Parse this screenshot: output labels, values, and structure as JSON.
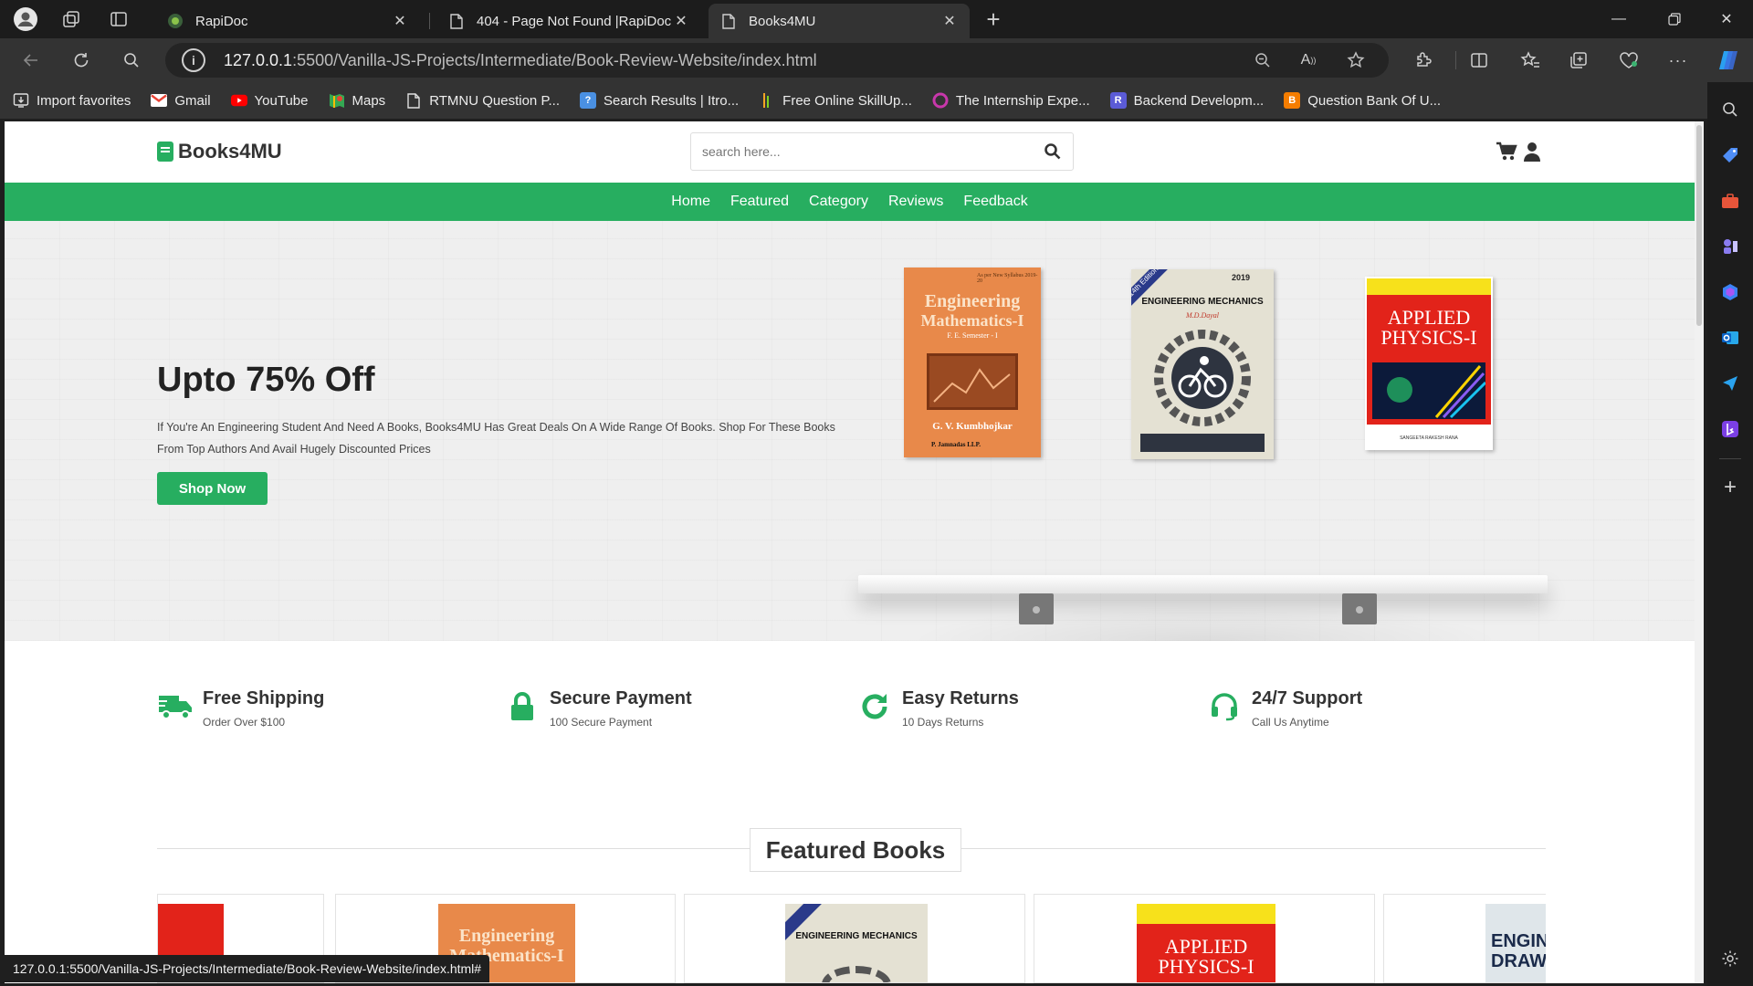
{
  "tabs": [
    {
      "title": "RapiDoc",
      "active": false
    },
    {
      "title": "404 - Page Not Found |RapiDoc",
      "active": false
    },
    {
      "title": "Books4MU",
      "active": true
    }
  ],
  "address_bar": {
    "url_host": "127.0.0.1",
    "url_path": ":5500/Vanilla-JS-Projects/Intermediate/Book-Review-Website/index.html"
  },
  "favorites": [
    {
      "label": "Import favorites",
      "icon": "import-icon"
    },
    {
      "label": "Gmail",
      "icon": "gmail-icon"
    },
    {
      "label": "YouTube",
      "icon": "youtube-icon"
    },
    {
      "label": "Maps",
      "icon": "maps-icon"
    },
    {
      "label": "RTMNU Question P...",
      "icon": "page-icon"
    },
    {
      "label": "Search Results | Itro...",
      "icon": "search-results-icon"
    },
    {
      "label": "Free Online SkillUp...",
      "icon": "skillup-icon"
    },
    {
      "label": "The Internship Expe...",
      "icon": "internship-icon"
    },
    {
      "label": "Backend Developm...",
      "icon": "backend-icon"
    },
    {
      "label": "Question Bank Of U...",
      "icon": "blogger-icon"
    }
  ],
  "site": {
    "logo": "Books4MU",
    "search_placeholder": "search here...",
    "nav": [
      "Home",
      "Featured",
      "Category",
      "Reviews",
      "Feedback"
    ],
    "hero": {
      "title": "Upto 75% Off",
      "description": "If You're An Engineering Student And Need A Books, Books4MU Has Great Deals On A Wide Range Of Books. Shop For These Books From Top Authors And Avail Hugely Discounted Prices",
      "button": "Shop Now"
    },
    "hero_books": [
      {
        "title_line1": "Engineering",
        "title_line2": "Mathematics-I",
        "subtitle": "F. E. Semester - I",
        "author": "G. V. Kumbhojkar",
        "publisher": "P. Jamnadas LLP.",
        "badge": "As per New Syllabus 2019-20"
      },
      {
        "title": "ENGINEERING MECHANICS",
        "author": "M.D.Dayal",
        "year": "2019",
        "edition": "14th Edition"
      },
      {
        "title_line1": "APPLIED",
        "title_line2": "PHYSICS-I",
        "author": "SANGEETA RAKESH RANA"
      }
    ],
    "features": [
      {
        "title": "Free Shipping",
        "subtitle": "Order Over $100",
        "icon": "truck-icon"
      },
      {
        "title": "Secure Payment",
        "subtitle": "100 Secure Payment",
        "icon": "lock-icon"
      },
      {
        "title": "Easy Returns",
        "subtitle": "10 Days Returns",
        "icon": "return-icon"
      },
      {
        "title": "24/7 Support",
        "subtitle": "Call Us Anytime",
        "icon": "headset-icon"
      }
    ],
    "featured_title": "Featured Books",
    "featured_cards": [
      {
        "label": ""
      },
      {
        "label": "Engineering Mathematics-I"
      },
      {
        "label": "ENGINEERING MECHANICS"
      },
      {
        "label": "APPLIED PHYSICS-I"
      },
      {
        "label": "ENGINE DRAWI"
      }
    ]
  },
  "status_bar": "127.0.0.1:5500/Vanilla-JS-Projects/Intermediate/Book-Review-Website/index.html#",
  "colors": {
    "accent": "#27ae60",
    "browser_dark": "#333333"
  }
}
